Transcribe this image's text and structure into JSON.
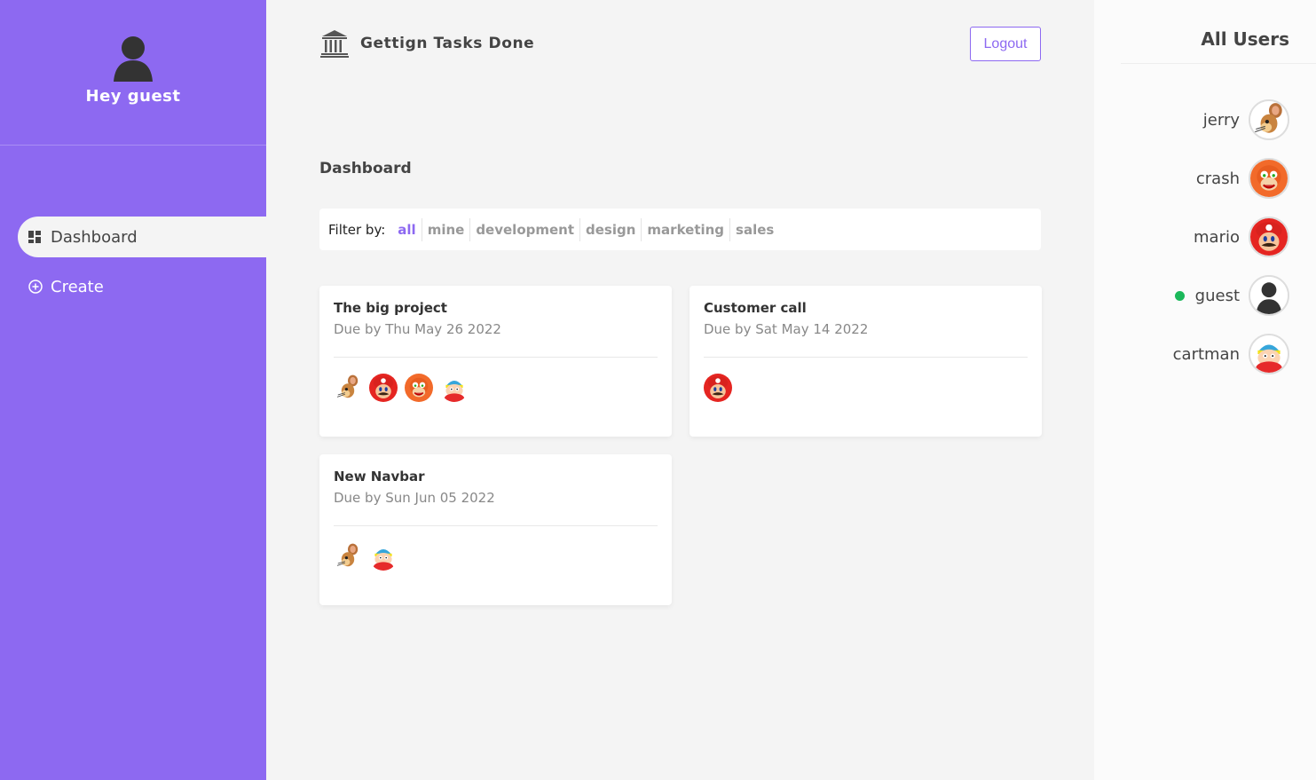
{
  "sidebar": {
    "greeting": "Hey guest",
    "nav": [
      {
        "label": "Dashboard",
        "icon": "dashboard-icon",
        "active": true
      },
      {
        "label": "Create",
        "icon": "add-circle-icon",
        "active": false
      }
    ]
  },
  "header": {
    "title": "Gettign Tasks Done",
    "logout_label": "Logout"
  },
  "main": {
    "page_title": "Dashboard",
    "filter": {
      "label": "Filter by:",
      "options": [
        "all",
        "mine",
        "development",
        "design",
        "marketing",
        "sales"
      ],
      "selected": "all"
    },
    "projects": [
      {
        "name": "The big project",
        "due": "Due by Thu May 26 2022",
        "assigned": [
          "jerry",
          "mario",
          "crash",
          "cartman"
        ]
      },
      {
        "name": "Customer call",
        "due": "Due by Sat May 14 2022",
        "assigned": [
          "mario"
        ]
      },
      {
        "name": "New Navbar",
        "due": "Due by Sun Jun 05 2022",
        "assigned": [
          "jerry",
          "cartman"
        ]
      }
    ]
  },
  "users_panel": {
    "title": "All Users",
    "users": [
      {
        "name": "jerry",
        "online": false
      },
      {
        "name": "crash",
        "online": false
      },
      {
        "name": "mario",
        "online": false
      },
      {
        "name": "guest",
        "online": true
      },
      {
        "name": "cartman",
        "online": false
      }
    ]
  },
  "colors": {
    "accent": "#8d69f1",
    "online": "#1bb85a"
  }
}
